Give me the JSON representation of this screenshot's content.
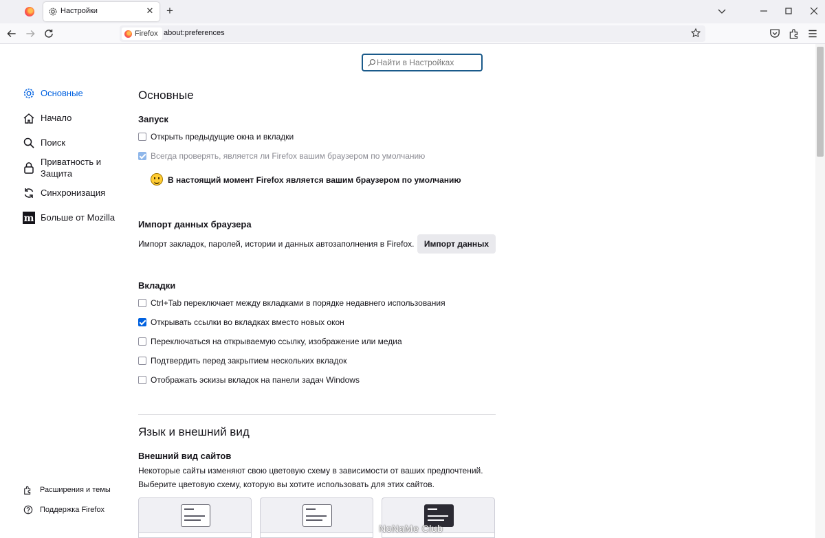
{
  "browser": {
    "tab_title": "Настройки",
    "new_tab": "+",
    "close_tab": "✕",
    "identity_label": "Firefox",
    "url": "about:preferences"
  },
  "search": {
    "placeholder": "Найти в Настройках"
  },
  "sidebar": {
    "items": [
      {
        "label": "Основные",
        "icon": "gear-icon",
        "active": true
      },
      {
        "label": "Начало",
        "icon": "home-icon"
      },
      {
        "label": "Поиск",
        "icon": "search-icon"
      },
      {
        "label": "Приватность и Защита",
        "icon": "lock-icon"
      },
      {
        "label": "Синхронизация",
        "icon": "sync-icon"
      },
      {
        "label": "Больше от Mozilla",
        "icon": "mozilla-icon"
      }
    ],
    "footer": [
      {
        "label": "Расширения и темы",
        "icon": "puzzle-icon"
      },
      {
        "label": "Поддержка Firefox",
        "icon": "help-icon"
      }
    ]
  },
  "main": {
    "title": "Основные",
    "startup": {
      "heading": "Запуск",
      "restore_session": {
        "label": "Открыть предыдущие окна и вкладки",
        "checked": false
      },
      "check_default": {
        "label": "Всегда проверять, является ли Firefox вашим браузером по умолчанию",
        "checked": true,
        "disabled": true
      },
      "default_status": "В настоящий момент Firefox является вашим браузером по умолчанию"
    },
    "import": {
      "heading": "Импорт данных браузера",
      "description": "Импорт закладок, паролей, истории и данных автозаполнения в Firefox.",
      "button": "Импорт данных"
    },
    "tabs": {
      "heading": "Вкладки",
      "options": [
        {
          "label": "Ctrl+Tab переключает между вкладками в порядке недавнего использования",
          "checked": false
        },
        {
          "label": "Открывать ссылки во вкладках вместо новых окон",
          "checked": true
        },
        {
          "label": "Переключаться на открываемую ссылку, изображение или медиа",
          "checked": false
        },
        {
          "label": "Подтвердить перед закрытием нескольких вкладок",
          "checked": false
        },
        {
          "label": "Отображать эскизы вкладок на панели задач Windows",
          "checked": false
        }
      ]
    },
    "appearance": {
      "title": "Язык и внешний вид",
      "heading": "Внешний вид сайтов",
      "description_line1": "Некоторые сайты изменяют свою цветовую схему в зависимости от ваших предпочтений.",
      "description_line2": "Выберите цветовую схему, которую вы хотите использовать для этих сайтов."
    }
  },
  "watermark": "NoNaMe Club",
  "colors": {
    "accent": "#0061e0",
    "search_border": "#1a5a8a"
  }
}
